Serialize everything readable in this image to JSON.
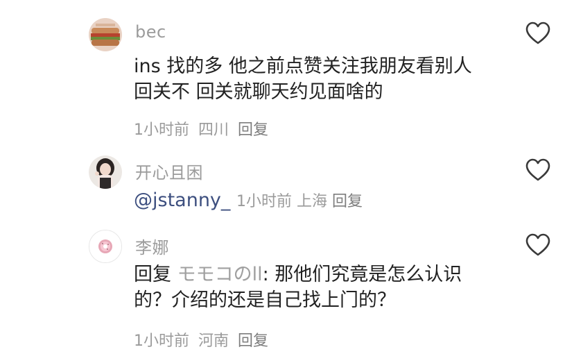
{
  "comments": [
    {
      "username": "bec",
      "content_lines": [
        "ins 找的多 他之前点赞关注我朋友看别人",
        "回关不 回关就聊天约见面啥的"
      ],
      "time": "1小时前",
      "location": "四川",
      "reply_label": "回复",
      "avatar_icon": "sandwich-photo-avatar",
      "like_icon": "heart-outline-icon"
    },
    {
      "username": "开心且困",
      "mention": "@jstanny_",
      "time": "1小时前",
      "location": "上海",
      "reply_label": "回复",
      "avatar_icon": "girl-photo-avatar",
      "like_icon": "heart-outline-icon"
    },
    {
      "username": "李娜",
      "reply_prefix": "回复",
      "reply_target": "モモコのll",
      "content_lines": [
        ": 那他们究竟是怎么认识",
        "的？介绍的还是自己找上门的？"
      ],
      "time": "1小时前",
      "location": "河南",
      "reply_label": "回复",
      "avatar_icon": "donut-avatar",
      "like_icon": "heart-outline-icon"
    }
  ],
  "colors": {
    "username": "#9b9b9b",
    "text": "#222222",
    "mention": "#3d4f7f",
    "meta": "#9a9a9a"
  }
}
